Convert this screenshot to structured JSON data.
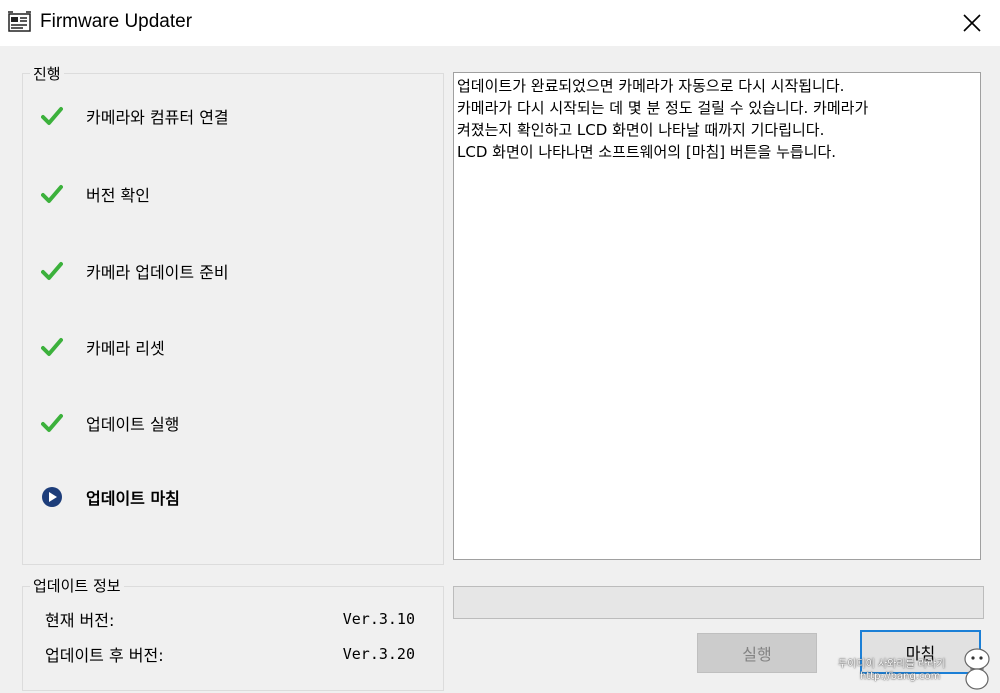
{
  "window": {
    "title": "Firmware Updater",
    "icon": "firmware-app-icon",
    "close_icon": "close-icon"
  },
  "progress_group": {
    "label": "진행",
    "steps": [
      {
        "label": "카메라와 컴퓨터 연결",
        "status": "done",
        "icon": "check-icon"
      },
      {
        "label": "버전 확인",
        "status": "done",
        "icon": "check-icon"
      },
      {
        "label": "카메라 업데이트 준비",
        "status": "done",
        "icon": "check-icon"
      },
      {
        "label": "카메라 리셋",
        "status": "done",
        "icon": "check-icon"
      },
      {
        "label": "업데이트 실행",
        "status": "done",
        "icon": "check-icon"
      },
      {
        "label": "업데이트 마침",
        "status": "current",
        "icon": "play-circle-icon"
      }
    ]
  },
  "info_group": {
    "label": "업데이트 정보",
    "current_version_label": "현재 버전:",
    "current_version_value": "Ver.3.10",
    "new_version_label": "업데이트 후 버전:",
    "new_version_value": "Ver.3.20"
  },
  "message": {
    "lines": [
      "업데이트가 완료되었으면 카메라가 자동으로 다시 시작됩니다.",
      "카메라가 다시 시작되는 데 몇 분 정도 걸릴 수 있습니다. 카메라가",
      "켜졌는지 확인하고 LCD 화면이 나타날 때까지 기다립니다.",
      "LCD 화면이 나타나면 소프트웨어의 [마침] 버튼을 누릅니다."
    ]
  },
  "progress_bar": {
    "value": 0
  },
  "buttons": {
    "run_label": "실행",
    "run_enabled": false,
    "finish_label": "마침"
  },
  "watermark": {
    "line1": "두이디이 사와리를 라라기",
    "line2": "http://bang.com"
  },
  "colors": {
    "check": "#3cb13c",
    "current_icon": "#1d3d7a",
    "focus_border": "#1b7fd6",
    "window_bg": "#f0f0f0"
  }
}
